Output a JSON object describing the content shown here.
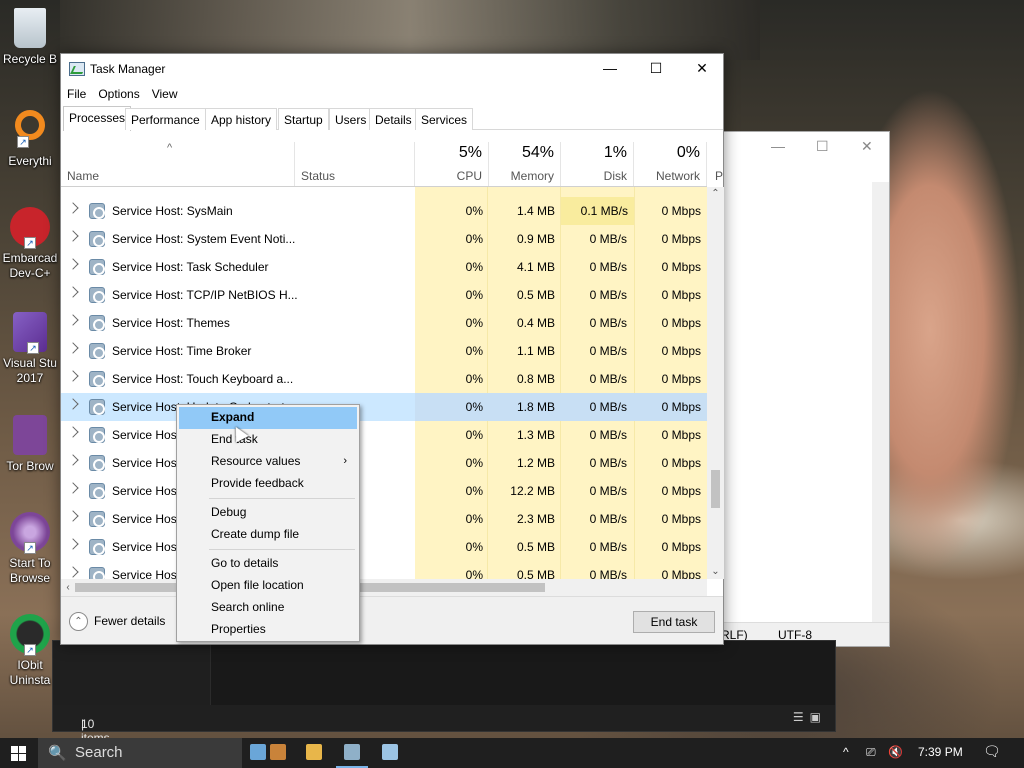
{
  "desktop": {
    "icons": [
      {
        "label": "Recycle B",
        "icon": "recycle-bin-icon"
      },
      {
        "label": "Everythi",
        "icon": "everything-search-icon"
      },
      {
        "label": "Embarcad Dev-C+",
        "icon": "dev-cpp-icon"
      },
      {
        "label": "Visual Stu 2017",
        "icon": "visual-studio-icon"
      },
      {
        "label": "Tor Brow",
        "icon": "tor-browser-icon"
      },
      {
        "label": "Start To Browse",
        "icon": "tor-start-icon"
      },
      {
        "label": "IObit Uninsta",
        "icon": "iobit-uninstaller-icon"
      }
    ]
  },
  "background_window": {
    "status_line_ending": "RLF)",
    "status_encoding": "UTF-8"
  },
  "dark_window": {
    "status_items": "10 items",
    "separator": "|"
  },
  "task_manager": {
    "title": "Task Manager",
    "caption_buttons": {
      "minimize": "—",
      "maximize": "☐",
      "close": "✕"
    },
    "menu": [
      "File",
      "Options",
      "View"
    ],
    "tabs": [
      "Processes",
      "Performance",
      "App history",
      "Startup",
      "Users",
      "Details",
      "Services"
    ],
    "active_tab": "Processes",
    "columns": {
      "name": "Name",
      "status": "Status",
      "cpu": {
        "label": "CPU",
        "usage": "5%"
      },
      "memory": {
        "label": "Memory",
        "usage": "54%"
      },
      "disk": {
        "label": "Disk",
        "usage": "1%"
      },
      "network": {
        "label": "Network",
        "usage": "0%"
      },
      "power_truncated": "P"
    },
    "sort_indicator": "^",
    "rows": [
      {
        "name": "Service Host: SysMain",
        "cpu": "0%",
        "memory": "1.4 MB",
        "disk": "0.1 MB/s",
        "network": "0 Mbps"
      },
      {
        "name": "Service Host: System Event Noti...",
        "cpu": "0%",
        "memory": "0.9 MB",
        "disk": "0 MB/s",
        "network": "0 Mbps"
      },
      {
        "name": "Service Host: Task Scheduler",
        "cpu": "0%",
        "memory": "4.1 MB",
        "disk": "0 MB/s",
        "network": "0 Mbps"
      },
      {
        "name": "Service Host: TCP/IP NetBIOS H...",
        "cpu": "0%",
        "memory": "0.5 MB",
        "disk": "0 MB/s",
        "network": "0 Mbps"
      },
      {
        "name": "Service Host: Themes",
        "cpu": "0%",
        "memory": "0.4 MB",
        "disk": "0 MB/s",
        "network": "0 Mbps"
      },
      {
        "name": "Service Host: Time Broker",
        "cpu": "0%",
        "memory": "1.1 MB",
        "disk": "0 MB/s",
        "network": "0 Mbps"
      },
      {
        "name": "Service Host: Touch Keyboard a...",
        "cpu": "0%",
        "memory": "0.8 MB",
        "disk": "0 MB/s",
        "network": "0 Mbps"
      },
      {
        "name": "Service Host: Update Orchestrat...",
        "cpu": "0%",
        "memory": "1.8 MB",
        "disk": "0 MB/s",
        "network": "0 Mbps"
      },
      {
        "name": "Service Host",
        "cpu": "0%",
        "memory": "1.3 MB",
        "disk": "0 MB/s",
        "network": "0 Mbps"
      },
      {
        "name": "Service Host",
        "cpu": "0%",
        "memory": "1.2 MB",
        "disk": "0 MB/s",
        "network": "0 Mbps"
      },
      {
        "name": "Service Host",
        "cpu": "0%",
        "memory": "12.2 MB",
        "disk": "0 MB/s",
        "network": "0 Mbps"
      },
      {
        "name": "Service Host",
        "cpu": "0%",
        "memory": "2.3 MB",
        "disk": "0 MB/s",
        "network": "0 Mbps"
      },
      {
        "name": "Service Host",
        "cpu": "0%",
        "memory": "0.5 MB",
        "disk": "0 MB/s",
        "network": "0 Mbps"
      },
      {
        "name": "Service Host",
        "cpu": "0%",
        "memory": "0.5 MB",
        "disk": "0 MB/s",
        "network": "0 Mbps"
      }
    ],
    "selected_row_index": 7,
    "footer": {
      "fewer_details": "Fewer details",
      "end_task": "End task"
    }
  },
  "context_menu": {
    "items": [
      {
        "label": "Expand",
        "bold": true,
        "highlighted": true
      },
      {
        "label": "End task"
      },
      {
        "label": "Resource values",
        "submenu_arrow": "›"
      },
      {
        "label": "Provide feedback"
      },
      {
        "separator": true
      },
      {
        "label": "Debug"
      },
      {
        "label": "Create dump file"
      },
      {
        "separator": true
      },
      {
        "label": "Go to details"
      },
      {
        "label": "Open file location"
      },
      {
        "label": "Search online"
      },
      {
        "label": "Properties"
      }
    ]
  },
  "taskbar": {
    "search_placeholder": "Search",
    "search_icon": "🔍",
    "clock": "7:39 PM",
    "apps": [
      {
        "icon": "paint-icon",
        "color": "#6aa6d8"
      },
      {
        "icon": "winrar-icon",
        "color": "#c9833a"
      },
      {
        "icon": "file-explorer-icon",
        "color": "#e8b64a"
      },
      {
        "icon": "task-manager-icon",
        "color": "#8fb0c8"
      },
      {
        "icon": "notepad-icon",
        "color": "#9cc4e4"
      }
    ],
    "tray_icons": [
      "chevron-up-icon",
      "network-icon",
      "volume-muted-icon"
    ],
    "tray_glyphs": {
      "chevron": "^",
      "network": "⎚",
      "volume": "🔇",
      "notification": "🗨"
    }
  },
  "colors": {
    "usage_highlight": "#fff4c4",
    "selected_row": "#cce8ff",
    "menu_highlight": "#91c9f7"
  }
}
